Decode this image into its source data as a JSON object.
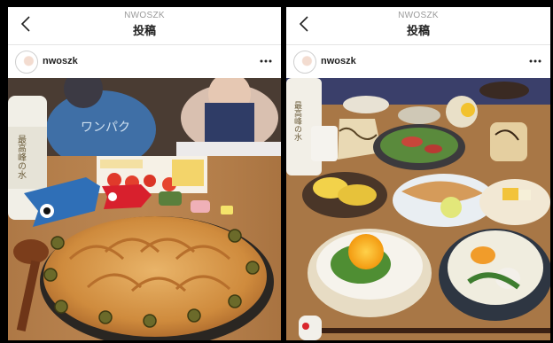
{
  "panels": [
    {
      "nav": {
        "username": "NWOSZK",
        "title": "投稿"
      },
      "post": {
        "username": "nwoszk",
        "photo_label": "",
        "bottle_text": "最高峰の水",
        "shirt_text": "ワンパク"
      }
    },
    {
      "nav": {
        "username": "NWOSZK",
        "title": "投稿"
      },
      "post": {
        "username": "nwoszk",
        "photo_label": "",
        "bottle_text": "最高峰の水"
      }
    }
  ],
  "icons": {
    "back": "chevron-left-icon",
    "more": "more-horizontal-icon"
  }
}
